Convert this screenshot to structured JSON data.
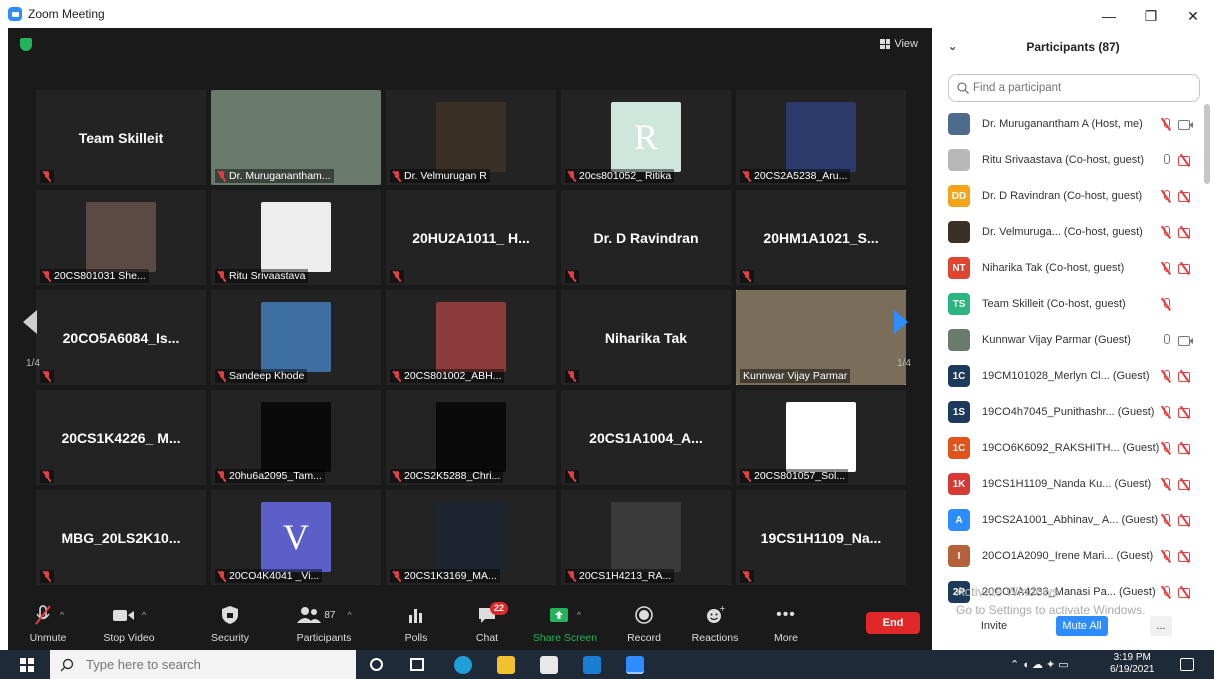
{
  "window": {
    "title": "Zoom Meeting",
    "controls": [
      "—",
      "❐",
      "✕"
    ]
  },
  "meeting": {
    "view_label": "View",
    "page_left": "1/4",
    "page_right": "1/4"
  },
  "tiles": [
    {
      "name": "Team Skilleit",
      "kind": "name"
    },
    {
      "name": "Dr. Muruganantham...",
      "kind": "photo",
      "color": "#6a7a6c"
    },
    {
      "name": "Dr. Velmurugan R",
      "kind": "photo",
      "color": "#3b3025"
    },
    {
      "name": "20cs801052_ Ritika",
      "kind": "photo",
      "color": "#cfe6dd",
      "letter": "R"
    },
    {
      "name": "20CS2A5238_Aru...",
      "kind": "photo",
      "color": "#2b3a6b"
    },
    {
      "name": "20CS801031 She...",
      "kind": "photo",
      "color": "#5b4a44"
    },
    {
      "name": "Ritu Srivaastava",
      "kind": "photo",
      "color": "#eeeeee"
    },
    {
      "name": "20HU2A1011_ H...",
      "kind": "name"
    },
    {
      "name": "Dr. D Ravindran",
      "kind": "name"
    },
    {
      "name": "20HM1A1021_S...",
      "kind": "name"
    },
    {
      "name": "20CO5A6084_Is...",
      "kind": "name"
    },
    {
      "name": "Sandeep Khode",
      "kind": "photo",
      "color": "#3e6fa2"
    },
    {
      "name": "20CS801002_ABH...",
      "kind": "photo",
      "color": "#8c3b3b"
    },
    {
      "name": "Niharika Tak",
      "kind": "name"
    },
    {
      "name": "Kunnwar Vijay Parmar",
      "kind": "video",
      "color": "#7a6d5a"
    },
    {
      "name": "20CS1K4226_ M...",
      "kind": "name"
    },
    {
      "name": "20hu6a2095_Tam...",
      "kind": "photo",
      "color": "#0a0a0a"
    },
    {
      "name": "20CS2K5288_Chri...",
      "kind": "photo",
      "color": "#0a0a0a"
    },
    {
      "name": "20CS1A1004_A...",
      "kind": "name"
    },
    {
      "name": "20CS801057_Sol...",
      "kind": "photo",
      "color": "#ffffff"
    },
    {
      "name": "MBG_20LS2K10...",
      "kind": "name"
    },
    {
      "name": "20CO4K4041 _Vi...",
      "kind": "photo",
      "color": "#5b5fc7",
      "letter": "V"
    },
    {
      "name": "20CS1K3169_MA...",
      "kind": "photo",
      "color": "#1d2530"
    },
    {
      "name": "20CS1H4213_RA...",
      "kind": "photo",
      "color": "#3a3a3a"
    },
    {
      "name": "19CS1H1109_Na...",
      "kind": "name"
    }
  ],
  "toolbar": {
    "unmute": "Unmute",
    "stop_video": "Stop Video",
    "security": "Security",
    "participants": "Participants",
    "participant_count": "87",
    "polls": "Polls",
    "chat": "Chat",
    "chat_badge": "22",
    "share_screen": "Share Screen",
    "record": "Record",
    "reactions": "Reactions",
    "more": "More",
    "end": "End"
  },
  "panel": {
    "title": "Participants (87)",
    "search_placeholder": "Find a participant",
    "participants": [
      {
        "initials": "",
        "name": "Dr. Muruganantham A (Host, me)",
        "avatar_color": "#4d6c8c",
        "mic": "off",
        "cam": "on"
      },
      {
        "initials": "",
        "name": "Ritu Srivaastava (Co-host, guest)",
        "avatar_color": "#b8b8b8",
        "mic": "on",
        "cam": "off"
      },
      {
        "initials": "DD",
        "name": "Dr. D Ravindran (Co-host, guest)",
        "avatar_color": "#f2a51a",
        "mic": "off",
        "cam": "off"
      },
      {
        "initials": "",
        "name": "Dr. Velmuruga...  (Co-host, guest)",
        "avatar_color": "#3b3025",
        "mic": "off",
        "cam": "off"
      },
      {
        "initials": "NT",
        "name": "Niharika Tak (Co-host, guest)",
        "avatar_color": "#e0452f",
        "mic": "off",
        "cam": "off"
      },
      {
        "initials": "TS",
        "name": "Team Skilleit (Co-host, guest)",
        "avatar_color": "#2cb57e",
        "mic": "off",
        "cam": "none"
      },
      {
        "initials": "",
        "name": "Kunnwar Vijay Parmar (Guest)",
        "avatar_color": "#6a7a6c",
        "mic": "on",
        "cam": "on"
      },
      {
        "initials": "1C",
        "name": "19CM101028_Merlyn Cl...  (Guest)",
        "avatar_color": "#1e3a5a",
        "mic": "off",
        "cam": "off"
      },
      {
        "initials": "1S",
        "name": "19CO4h7045_Punithashr...  (Guest)",
        "avatar_color": "#1e3a5a",
        "mic": "off",
        "cam": "off"
      },
      {
        "initials": "1C",
        "name": "19CO6K6092_RAKSHITH...  (Guest)",
        "avatar_color": "#e0531a",
        "mic": "off",
        "cam": "off"
      },
      {
        "initials": "1K",
        "name": "19CS1H1109_Nanda Ku...  (Guest)",
        "avatar_color": "#d63a32",
        "mic": "off",
        "cam": "off"
      },
      {
        "initials": "A",
        "name": "19CS2A1001_Abhinav_ A...  (Guest)",
        "avatar_color": "#2d8cff",
        "mic": "off",
        "cam": "off"
      },
      {
        "initials": "I",
        "name": "20CO1A2090_Irene Mari...  (Guest)",
        "avatar_color": "#b5613a",
        "mic": "off",
        "cam": "off"
      },
      {
        "initials": "2P",
        "name": "20CO1A4233_Manasi Pa...  (Guest)",
        "avatar_color": "#1e3a5a",
        "mic": "off",
        "cam": "off"
      }
    ],
    "invite": "Invite",
    "mute_all": "Mute All",
    "more": "..."
  },
  "watermark": {
    "line1": "Activate Windows",
    "line2": "Go to Settings to activate Windows."
  },
  "taskbar": {
    "search_placeholder": "Type here to search",
    "time": "3:19 PM",
    "date": "6/19/2021"
  }
}
